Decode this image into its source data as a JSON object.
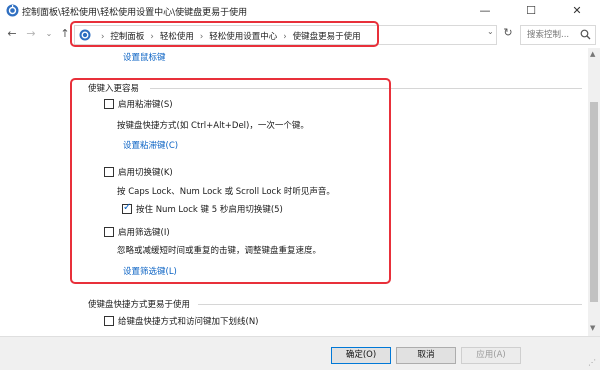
{
  "window": {
    "title": "控制面板\\轻松使用\\轻松使用设置中心\\使键盘更易于使用",
    "controls": {
      "minimize": "—",
      "maximize": "☐",
      "close": "✕"
    }
  },
  "nav": {
    "back": "←",
    "forward": "→",
    "recent": "⌄",
    "up": "↑",
    "breadcrumbs": [
      "控制面板",
      "轻松使用",
      "轻松使用设置中心",
      "使键盘更易于使用"
    ],
    "separator": "›",
    "dropdown": "⌄",
    "refresh": "↻",
    "search_placeholder": "搜索控制..."
  },
  "content": {
    "top_link": "设置鼠标键",
    "section_easy": {
      "title": "使键入更容易",
      "sticky": {
        "label": "启用粘滞键(S)",
        "checked": false,
        "description": "按键盘快捷方式(如 Ctrl+Alt+Del)，一次一个键。",
        "link": "设置粘滞键(C)"
      },
      "toggle": {
        "label": "启用切换键(K)",
        "checked": false,
        "description": "按 Caps Lock、Num Lock 或 Scroll Lock 时听见声音。",
        "sub_label": "按住 Num Lock 键 5 秒启用切换键(5)",
        "sub_checked": true
      },
      "filter": {
        "label": "启用筛选键(I)",
        "checked": false,
        "description": "忽略或减缓短时间或重复的击键，调整键盘重复速度。",
        "link": "设置筛选键(L)"
      }
    },
    "section_shortcuts": {
      "title": "使键盘快捷方式更易于使用",
      "underline": {
        "label": "给键盘快捷方式和访问键加下划线(N)",
        "checked": false
      }
    }
  },
  "buttons": {
    "ok": "确定(O)",
    "cancel": "取消",
    "apply": "应用(A)"
  },
  "colors": {
    "highlight_box": "#e8303a",
    "link": "#0b63c4",
    "check": "#0b63c4"
  }
}
